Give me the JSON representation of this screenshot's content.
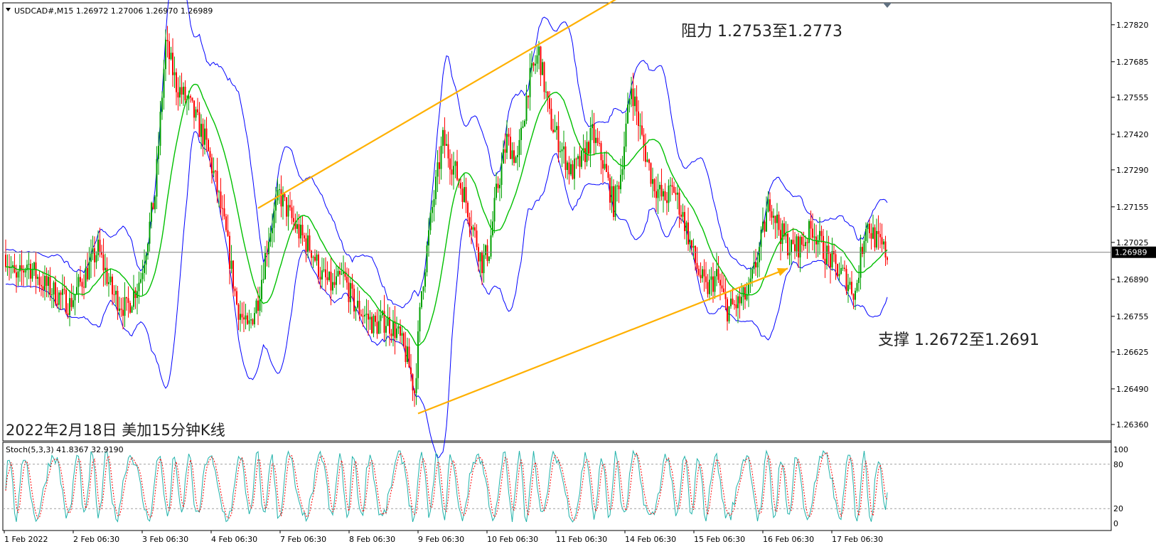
{
  "header": {
    "symbol_line": "USDCAD#,M15  1.26972 1.27006 1.26970 1.26989",
    "overlay_title": "2022年2月18日 美加15分钟K线",
    "stoch_line": "Stoch(5,3,3) 41.8367 32.9190"
  },
  "annotations": {
    "resistance": "阻力 1.2753至1.2773",
    "support": "支撑 1.2672至1.2691"
  },
  "colors": {
    "background": "#ffffff",
    "frame": "#000000",
    "bull_candle": "#00a000",
    "bear_candle": "#ff0000",
    "bollinger": "#0000ff",
    "moving_average": "#00c000",
    "trend_arrow": "#ffb000",
    "stoch_main": "#20b2aa",
    "stoch_signal": "#ff0000"
  },
  "chart_data": {
    "type": "candlestick",
    "symbol": "USDCAD#",
    "timeframe": "M15",
    "price_axis": {
      "ylim": [
        1.263,
        1.279
      ],
      "ticks": [
        "1.27820",
        "1.27685",
        "1.27555",
        "1.27420",
        "1.27290",
        "1.27155",
        "1.27025",
        "1.26890",
        "1.26755",
        "1.26625",
        "1.26490",
        "1.26360"
      ],
      "current_price": "1.26989"
    },
    "time_axis": {
      "ticks": [
        "1 Feb 2022",
        "2 Feb 06:30",
        "3 Feb 06:30",
        "4 Feb 06:30",
        "7 Feb 06:30",
        "8 Feb 06:30",
        "9 Feb 06:30",
        "10 Feb 06:30",
        "11 Feb 06:30",
        "14 Feb 06:30",
        "15 Feb 06:30",
        "16 Feb 06:30",
        "17 Feb 06:30"
      ]
    },
    "price_path": [
      [
        0,
        1.2698
      ],
      [
        6,
        1.2688
      ],
      [
        12,
        1.2695
      ],
      [
        20,
        1.2688
      ],
      [
        28,
        1.2684
      ],
      [
        36,
        1.268
      ],
      [
        44,
        1.269
      ],
      [
        52,
        1.27
      ],
      [
        60,
        1.2684
      ],
      [
        68,
        1.2678
      ],
      [
        76,
        1.269
      ],
      [
        84,
        1.272
      ],
      [
        90,
        1.2775
      ],
      [
        96,
        1.276
      ],
      [
        104,
        1.2752
      ],
      [
        112,
        1.274
      ],
      [
        118,
        1.2725
      ],
      [
        124,
        1.2705
      ],
      [
        130,
        1.268
      ],
      [
        136,
        1.267
      ],
      [
        142,
        1.2682
      ],
      [
        148,
        1.2705
      ],
      [
        154,
        1.272
      ],
      [
        160,
        1.2712
      ],
      [
        166,
        1.2705
      ],
      [
        172,
        1.27
      ],
      [
        178,
        1.269
      ],
      [
        184,
        1.2686
      ],
      [
        190,
        1.269
      ],
      [
        196,
        1.268
      ],
      [
        202,
        1.2676
      ],
      [
        208,
        1.2672
      ],
      [
        214,
        1.2674
      ],
      [
        220,
        1.267
      ],
      [
        226,
        1.266
      ],
      [
        230,
        1.2648
      ],
      [
        234,
        1.2685
      ],
      [
        240,
        1.2715
      ],
      [
        246,
        1.274
      ],
      [
        252,
        1.273
      ],
      [
        258,
        1.272
      ],
      [
        264,
        1.2705
      ],
      [
        268,
        1.2695
      ],
      [
        272,
        1.27
      ],
      [
        276,
        1.272
      ],
      [
        282,
        1.274
      ],
      [
        288,
        1.2732
      ],
      [
        294,
        1.276
      ],
      [
        300,
        1.2772
      ],
      [
        306,
        1.2748
      ],
      [
        312,
        1.2738
      ],
      [
        318,
        1.2728
      ],
      [
        324,
        1.2732
      ],
      [
        330,
        1.2742
      ],
      [
        336,
        1.2732
      ],
      [
        342,
        1.2716
      ],
      [
        346,
        1.2728
      ],
      [
        352,
        1.276
      ],
      [
        358,
        1.274
      ],
      [
        364,
        1.2725
      ],
      [
        370,
        1.2718
      ],
      [
        376,
        1.2722
      ],
      [
        382,
        1.271
      ],
      [
        388,
        1.2695
      ],
      [
        394,
        1.2685
      ],
      [
        400,
        1.269
      ],
      [
        406,
        1.2678
      ],
      [
        412,
        1.268
      ],
      [
        418,
        1.2684
      ],
      [
        424,
        1.27
      ],
      [
        430,
        1.2718
      ],
      [
        436,
        1.2706
      ],
      [
        442,
        1.27
      ],
      [
        448,
        1.2702
      ],
      [
        454,
        1.2708
      ],
      [
        460,
        1.27
      ],
      [
        466,
        1.2694
      ],
      [
        472,
        1.269
      ],
      [
        478,
        1.2684
      ],
      [
        484,
        1.271
      ],
      [
        490,
        1.2703
      ],
      [
        496,
        1.2698
      ]
    ],
    "bollinger_band_halfwidth": 0.0014,
    "trendlines": [
      {
        "role": "resistance",
        "from": [
          142,
          1.2715
        ],
        "to": [
          398,
          1.2812
        ]
      },
      {
        "role": "support",
        "from": [
          232,
          1.264
        ],
        "to": [
          440,
          1.2693
        ]
      }
    ],
    "stochastic": {
      "params": "5,3,3",
      "main": 41.8367,
      "signal": 32.919,
      "ylim": [
        0,
        100
      ],
      "levels": [
        "100",
        "80",
        "20",
        "0"
      ]
    }
  }
}
